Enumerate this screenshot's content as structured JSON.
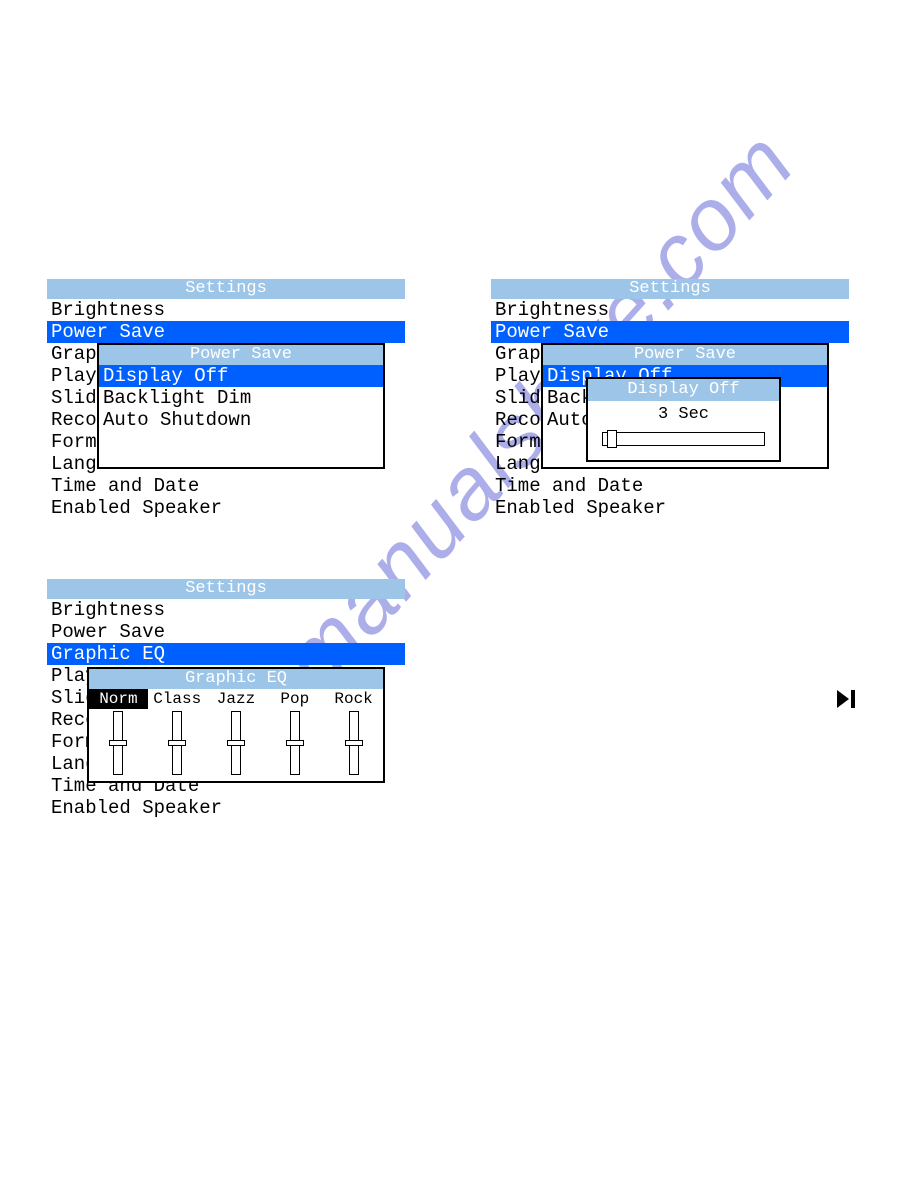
{
  "watermark_text": "manualshive.com",
  "panel_title": "Settings",
  "menu": {
    "brightness": "Brightness",
    "power_save": "Power Save",
    "graphic_eq": "Graphic EQ",
    "play_mode": "Play Mode",
    "slideshow": "Slideshow",
    "recording": "Recording",
    "format": "Format",
    "language": "Language",
    "time_date": "Time and Date",
    "enabled_speaker": "Enabled Speaker",
    "play_trunc": "Play",
    "slide_trunc": "Slid",
    "reco_trunc": "Reco",
    "form_trunc": "Form",
    "lang_trunc": "Langu",
    "graphi_trunc": "Graphi",
    "time_trunc": "Time and Date",
    "reco2_trunc": "Reco",
    "slide2_trunc": "Slid",
    "play2_trunc": "Play",
    "backl_trunc": "Backl",
    "auto_trunc": "Auto"
  },
  "power_save_popup": {
    "title": "Power Save",
    "display_off": "Display Off",
    "backlight_dim": "Backlight Dim",
    "auto_shutdown": "Auto Shutdown"
  },
  "display_off_popup": {
    "title": "Display Off",
    "value": "3 Sec"
  },
  "eq_popup": {
    "title": "Graphic EQ",
    "norm": "Norm",
    "class": "Class",
    "jazz": "Jazz",
    "pop": "Pop",
    "rock": "Rock"
  }
}
